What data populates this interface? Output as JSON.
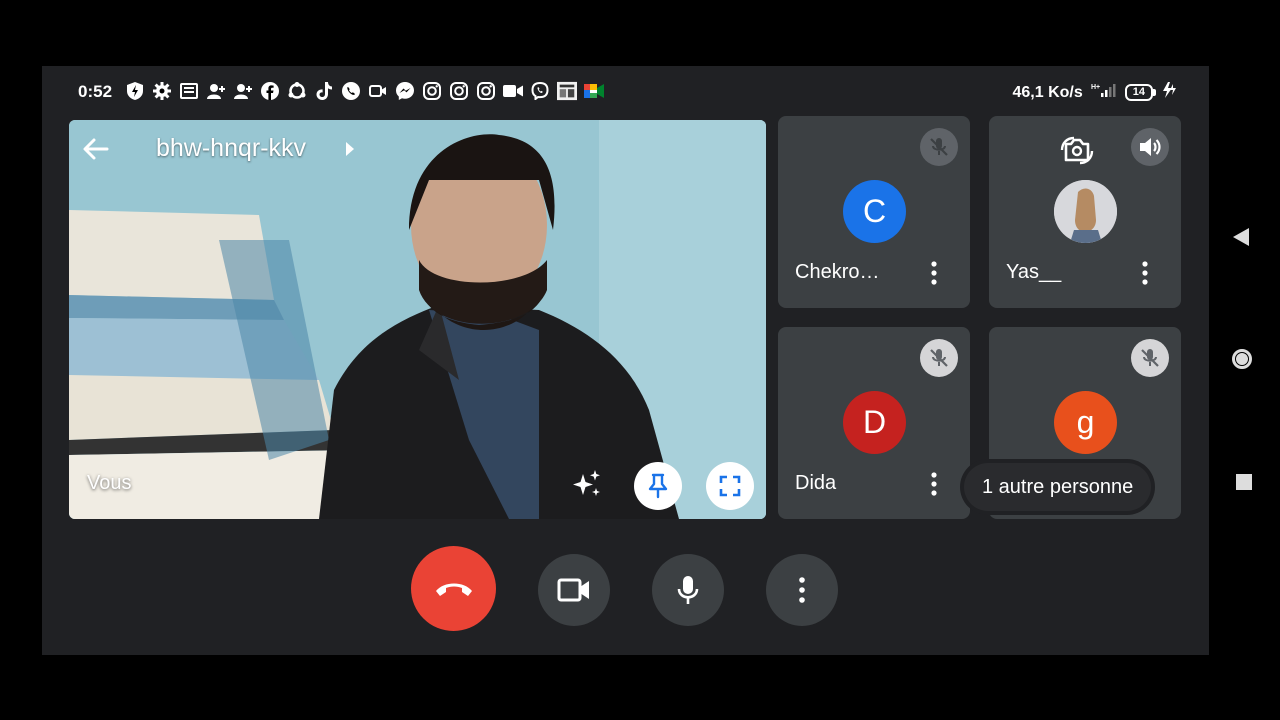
{
  "status_bar": {
    "time": "0:52",
    "network_speed": "46,1 Ko/s",
    "battery_level": "14",
    "icons": [
      "bolt-shield-icon",
      "settings-icon",
      "news-icon",
      "user-add-icon",
      "user-add-icon",
      "facebook-icon",
      "sync-icon",
      "tiktok-icon",
      "whatsapp-icon",
      "video-icon",
      "messenger-icon",
      "instagram-icon",
      "instagram-icon",
      "instagram-icon",
      "camera-icon",
      "viber-icon",
      "app-icon",
      "meet-icon"
    ]
  },
  "meeting": {
    "code": "bhw-hnqr-kkv",
    "self_label": "Vous"
  },
  "participants": [
    {
      "name": "Chekro…",
      "initial": "C",
      "color": "#1a73e8",
      "muted": true
    },
    {
      "name": "Yas__",
      "initial": "",
      "color": "#c9c9cc",
      "muted": false
    },
    {
      "name": "Dida",
      "initial": "D",
      "color": "#c5221f",
      "muted": true
    },
    {
      "name": "",
      "initial": "g",
      "color": "#e8501c",
      "muted": true
    }
  ],
  "others_chip": "1 autre personne",
  "colors": {
    "background": "#202124",
    "tile": "#3c4043",
    "end_call": "#ea4335"
  }
}
